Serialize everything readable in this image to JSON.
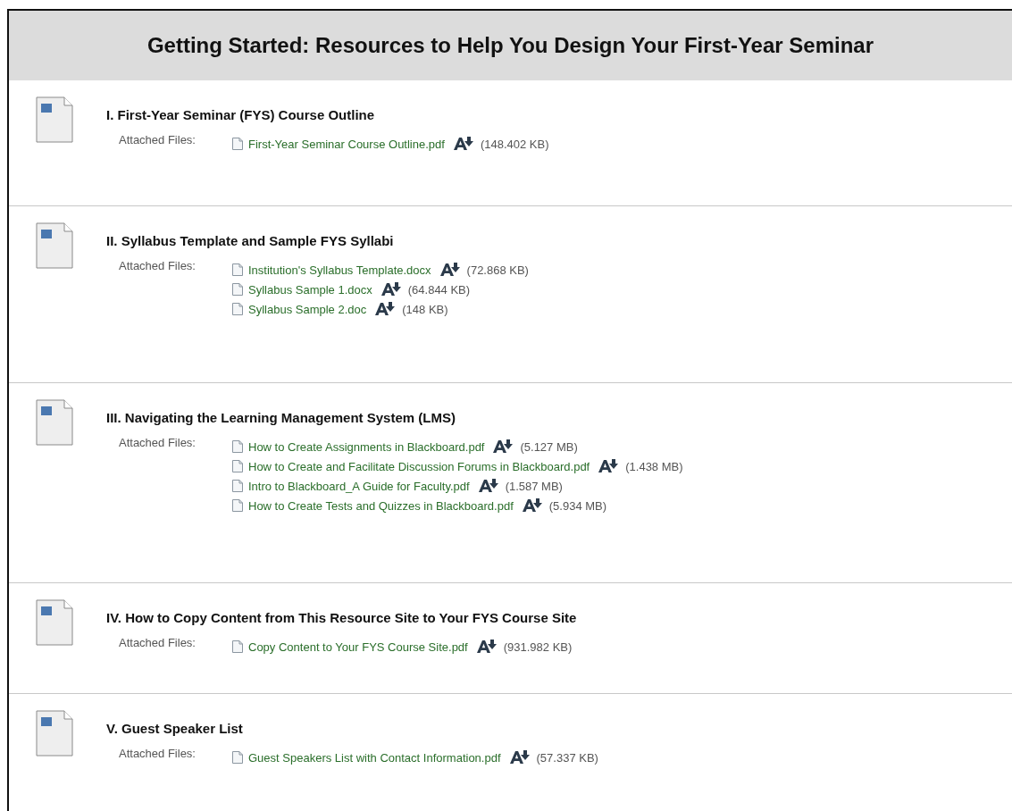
{
  "header": {
    "title": "Getting Started: Resources to Help You Design Your First-Year Seminar"
  },
  "items": [
    {
      "title": "I. First-Year Seminar (FYS) Course Outline",
      "attached_label": "Attached Files:",
      "files": [
        {
          "name": "First-Year Seminar Course Outline.pdf",
          "size": "(148.402 KB)"
        }
      ]
    },
    {
      "title": "II. Syllabus Template and Sample FYS Syllabi",
      "attached_label": "Attached Files:",
      "files": [
        {
          "name": "Institution's Syllabus Template.docx",
          "size": "(72.868 KB)"
        },
        {
          "name": "Syllabus Sample 1.docx",
          "size": "(64.844 KB)"
        },
        {
          "name": "Syllabus Sample 2.doc",
          "size": "(148 KB)"
        }
      ]
    },
    {
      "title": "III. Navigating the Learning Management System (LMS)",
      "attached_label": "Attached Files:",
      "files": [
        {
          "name": "How to Create Assignments in Blackboard.pdf",
          "size": "(5.127 MB)"
        },
        {
          "name": "How to Create and Facilitate Discussion Forums in Blackboard.pdf",
          "size": "(1.438 MB)"
        },
        {
          "name": "Intro to Blackboard_A Guide for Faculty.pdf",
          "size": "(1.587 MB)"
        },
        {
          "name": "How to Create Tests and Quizzes in Blackboard.pdf",
          "size": "(5.934 MB)"
        }
      ]
    },
    {
      "title": "IV. How to Copy Content from This Resource Site to Your FYS Course Site",
      "attached_label": "Attached Files:",
      "files": [
        {
          "name": "Copy Content to Your FYS Course Site.pdf",
          "size": "(931.982 KB)"
        }
      ]
    },
    {
      "title": "V. Guest Speaker List",
      "attached_label": "Attached Files:",
      "files": [
        {
          "name": "Guest Speakers List with Contact Information.pdf",
          "size": "(57.337 KB)"
        }
      ]
    }
  ]
}
